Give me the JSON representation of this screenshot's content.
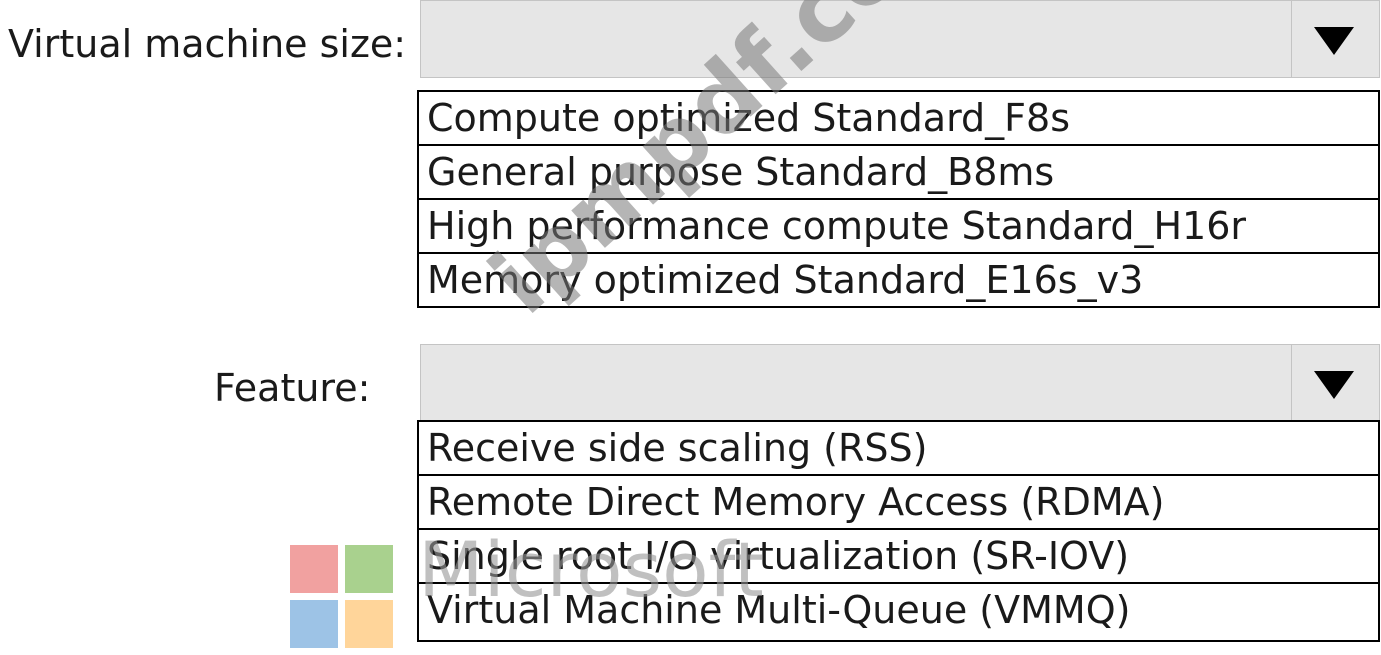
{
  "vm_size": {
    "label": "Virtual machine size:",
    "selected": "",
    "options": [
      "Compute optimized Standard_F8s",
      "General purpose Standard_B8ms",
      "High performance compute Standard_H16r",
      "Memory optimized Standard_E16s_v3"
    ]
  },
  "feature": {
    "label": "Feature:",
    "selected": "",
    "options": [
      "Receive side scaling (RSS)",
      "Remote Direct Memory Access (RDMA)",
      "Single root I/O virtualization (SR-IOV)",
      "Virtual Machine Multi-Queue (VMMQ)"
    ]
  },
  "watermark": {
    "site_text": "ipmpdf.com",
    "brand_text": "Microsoft",
    "logo_colors": {
      "red": "#f1a1a0",
      "green": "#a9d18e",
      "blue": "#9dc3e6",
      "yellow": "#ffd59a"
    }
  },
  "colors": {
    "dropdown_fill": "#e6e6e6",
    "dropdown_border": "#c4c4c4",
    "list_border": "#000000",
    "arrow": "#000000"
  },
  "icons": {
    "dropdown_arrow": "chevron-down-icon",
    "logo": "microsoft-logo-icon"
  }
}
